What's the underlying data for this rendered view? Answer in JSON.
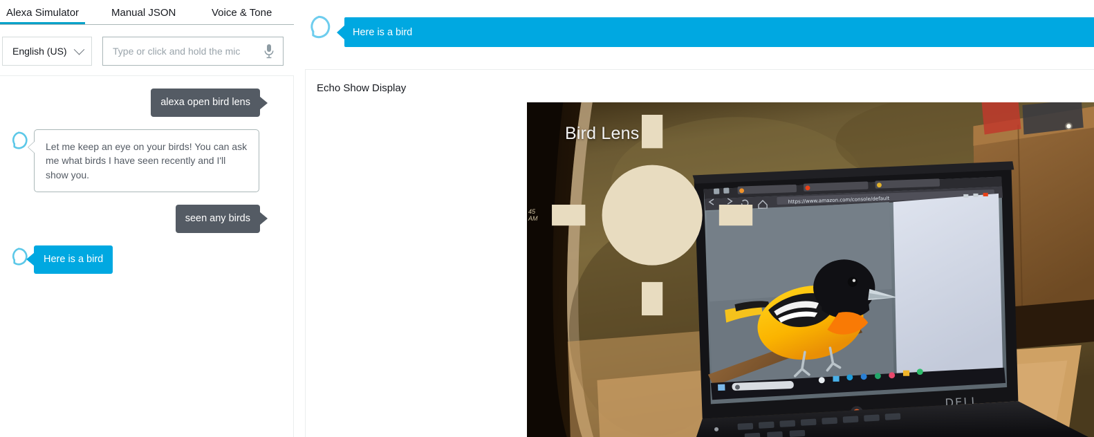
{
  "tabs": [
    {
      "label": "Alexa Simulator",
      "active": true
    },
    {
      "label": "Manual JSON",
      "active": false
    },
    {
      "label": "Voice & Tone",
      "active": false
    }
  ],
  "controls": {
    "language": "English (US)",
    "chevron_icon": "chevron-down-icon",
    "utterance_value": "",
    "utterance_placeholder": "Type or click and hold the mic",
    "mic_icon": "microphone-icon"
  },
  "conversation": [
    {
      "role": "user",
      "text": "alexa open bird lens"
    },
    {
      "role": "alexa",
      "style": "card",
      "text": "Let me keep an eye on your birds! You can ask me what birds I have seen recently and I'll show you."
    },
    {
      "role": "user",
      "text": "seen any birds"
    },
    {
      "role": "alexa",
      "style": "speak",
      "text": "Here is a bird"
    }
  ],
  "banner": {
    "text": "Here is a bird",
    "alexa_icon": "alexa-ring-icon",
    "color": "#00a8e1"
  },
  "display": {
    "title": "Echo Show Display",
    "photo_label": "Bird Lens",
    "photo_clock": "45 AM",
    "photo_weather_icon": "sun-icon",
    "photo_alt": "Baltimore Oriole on a branch shown on a laptop screen"
  },
  "colors": {
    "accent": "#00a8e1",
    "tab_underline": "#00a1c9",
    "user_bubble": "#545b64",
    "text": "#16191f",
    "border": "#aab7b8"
  }
}
